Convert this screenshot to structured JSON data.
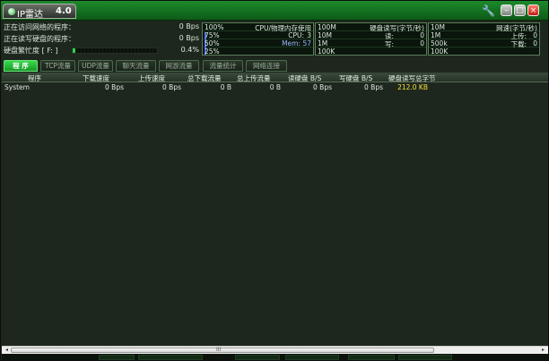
{
  "window": {
    "title": "IP雷达",
    "version": "4.0",
    "buttons": {
      "tools_glyph": "🔧",
      "minimize_glyph": "–",
      "maximize_glyph": "□",
      "close_glyph": "×"
    }
  },
  "info": {
    "net_programs_label": "正在访问网络的程序：",
    "net_programs_value": "0 Bps",
    "disk_programs_label": "正在读写硬盘的程序：",
    "disk_programs_value": "0 Bps",
    "disk_busy_label": "硬盘繁忙度 [ F: ]",
    "disk_busy_value": "0.4%",
    "disk_busy_fraction": 0.004
  },
  "panels": {
    "cpu": {
      "y_labels": [
        "100%",
        "75%",
        "50%",
        "25%"
      ],
      "title": "CPU/物理内存使用",
      "cpu_label": "CPU:",
      "cpu_value": "3",
      "mem_label": "Mem:",
      "mem_value": "57"
    },
    "disk": {
      "y_labels": [
        "100M",
        "10M",
        "1M",
        "100K"
      ],
      "title": "硬盘读写(字节/秒)",
      "read_label": "读:",
      "read_value": "0",
      "write_label": "写:",
      "write_value": "0"
    },
    "net": {
      "y_labels": [
        "10M",
        "1M",
        "500k",
        "100K"
      ],
      "title": "网速(字节/秒)",
      "up_label": "上传:",
      "up_value": "0",
      "down_label": "下载:",
      "down_value": "0"
    }
  },
  "tabs": [
    "程 序",
    "TCP流量",
    "UDP流量",
    "聊天流量",
    "网游流量",
    "流量统计",
    "网络连接"
  ],
  "active_tab": 0,
  "table": {
    "columns": [
      "程序",
      "下载速度",
      "上传速度",
      "总下载流量",
      "总上传流量",
      "读硬盘 B/S",
      "写硬盘 B/S",
      "硬盘读写总字节"
    ],
    "rows": [
      [
        "System",
        "0 Bps",
        "0 Bps",
        "0 B",
        "0 B",
        "0 Bps",
        "0 Bps",
        "212.0 KB"
      ]
    ]
  },
  "scrollbar": {
    "grip_glyph": "III",
    "left_arrow": "◂",
    "right_arrow": "▸"
  },
  "colors": {
    "accent": "#1d8a2c",
    "highlight": "#f4e03a",
    "cpu_trace": "#4d6cff"
  }
}
